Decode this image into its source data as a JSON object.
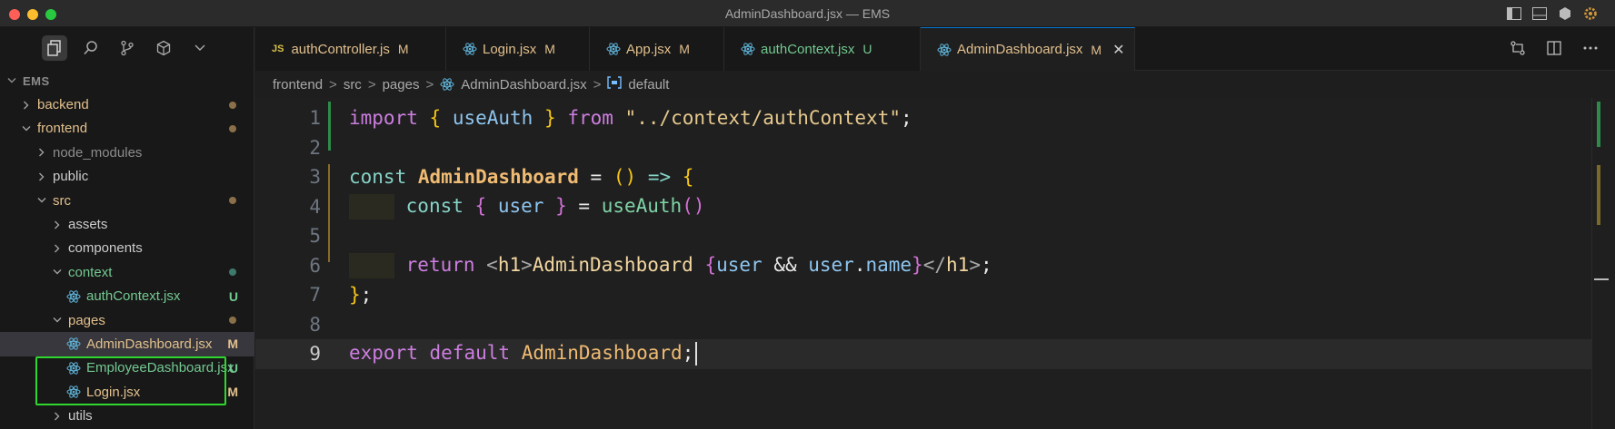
{
  "window": {
    "title": "AdminDashboard.jsx — EMS"
  },
  "explorer": {
    "section": "EMS",
    "items": [
      {
        "label": "backend",
        "indent": 0,
        "kind": "folder",
        "open": false,
        "status": "dot"
      },
      {
        "label": "frontend",
        "indent": 0,
        "kind": "folder",
        "open": true,
        "status": "dot"
      },
      {
        "label": "node_modules",
        "indent": 1,
        "kind": "folder-dim",
        "open": false,
        "status": ""
      },
      {
        "label": "public",
        "indent": 1,
        "kind": "folder-plain",
        "open": false,
        "status": ""
      },
      {
        "label": "src",
        "indent": 1,
        "kind": "folder",
        "open": true,
        "status": "dot"
      },
      {
        "label": "assets",
        "indent": 2,
        "kind": "folder-plain",
        "open": false,
        "status": ""
      },
      {
        "label": "components",
        "indent": 2,
        "kind": "folder-plain",
        "open": false,
        "status": ""
      },
      {
        "label": "context",
        "indent": 2,
        "kind": "folder-ctx",
        "open": true,
        "status": "dot-green"
      },
      {
        "label": "authContext.jsx",
        "indent": 3,
        "kind": "file-u",
        "open": false,
        "status": "U"
      },
      {
        "label": "pages",
        "indent": 2,
        "kind": "folder",
        "open": true,
        "status": "dot"
      },
      {
        "label": "AdminDashboard.jsx",
        "indent": 3,
        "kind": "file-m",
        "open": false,
        "status": "M",
        "selected": true
      },
      {
        "label": "EmployeeDashboard.jsx",
        "indent": 3,
        "kind": "file-u",
        "open": false,
        "status": "U"
      },
      {
        "label": "Login.jsx",
        "indent": 3,
        "kind": "file-m",
        "open": false,
        "status": "M"
      },
      {
        "label": "utils",
        "indent": 2,
        "kind": "folder-plain",
        "open": false,
        "status": ""
      }
    ]
  },
  "tabs": [
    {
      "label": "authController.js",
      "badge": "M",
      "icon": "js-file-icon",
      "active": false
    },
    {
      "label": "Login.jsx",
      "badge": "M",
      "icon": "react-icon",
      "active": false
    },
    {
      "label": "App.jsx",
      "badge": "M",
      "icon": "react-icon",
      "active": false
    },
    {
      "label": "authContext.jsx",
      "badge": "U",
      "icon": "react-icon",
      "active": false
    },
    {
      "label": "AdminDashboard.jsx",
      "badge": "M",
      "icon": "react-icon",
      "active": true,
      "close": "✕"
    }
  ],
  "breadcrumb": {
    "items": [
      "frontend",
      "src",
      "pages",
      "AdminDashboard.jsx",
      "default"
    ],
    "separator": ">"
  },
  "editor": {
    "line_numbers": [
      "1",
      "2",
      "3",
      "4",
      "5",
      "6",
      "7",
      "8",
      "9"
    ],
    "current_line": 9,
    "code": {
      "l1": {
        "kw_import": "import",
        "b_open": "{",
        "ident": "useAuth",
        "b_close": "}",
        "kw_from": "from",
        "str": "\"../context/authContext\"",
        "semi": ";"
      },
      "l3": {
        "kw_const": "const",
        "name": "AdminDashboard",
        "eq": "=",
        "parens": "()",
        "arrow": "=>",
        "brace": "{"
      },
      "l4": {
        "kw_const": "const",
        "b_open": "{",
        "ident": "user",
        "b_close": "}",
        "eq": "=",
        "fn": "useAuth",
        "parens": "()"
      },
      "l6": {
        "kw_return": "return",
        "lt1": "<",
        "tag1": "h1",
        "gt1": ">",
        "text": "AdminDashboard ",
        "b_open": "{",
        "v1": "user",
        "and": " && ",
        "v2": "user",
        "dot": ".",
        "prop": "name",
        "b_close": "}",
        "lt2": "</",
        "tag2": "h1",
        "gt2": ">",
        "semi": ";"
      },
      "l7": {
        "brace": "}",
        "semi": ";"
      },
      "l9": {
        "kw_export": "export",
        "kw_default": "default",
        "name": "AdminDashboard",
        "semi": ";"
      }
    }
  },
  "colors": {
    "accent": "#0078d4",
    "modified": "#e2c08d",
    "untracked": "#73c991",
    "highlight_box": "#2fd62f"
  }
}
